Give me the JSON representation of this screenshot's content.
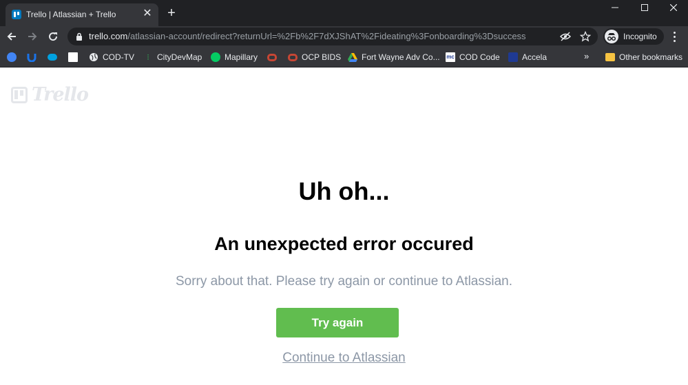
{
  "browser": {
    "tab": {
      "title": "Trello | Atlassian + Trello",
      "close": "✕"
    },
    "new_tab": "+",
    "omnibox": {
      "url_host": "trello.com",
      "url_path": "/atlassian-account/redirect?returnUrl=%2Fb%2F7dXJShAT%2Fideating%3Fonboarding%3Dsuccess"
    },
    "profile_label": "Incognito"
  },
  "bookmarks": {
    "items": [
      {
        "label": "",
        "icon": "arrow-circle-icon",
        "color": "#4285f4"
      },
      {
        "label": "",
        "icon": "magnet-icon",
        "color": "#1a73e8"
      },
      {
        "label": "",
        "icon": "salesforce-cloud-icon",
        "color": "#00a1e0"
      },
      {
        "label": "",
        "icon": "adobe-icon",
        "color": "#ffffff"
      },
      {
        "label": "COD-TV",
        "icon": "globe-icon",
        "color": "#e8eaed"
      },
      {
        "label": "CityDevMap",
        "icon": "map-icon",
        "color": "#34a853"
      },
      {
        "label": "Mapillary",
        "icon": "mapillary-icon",
        "color": "#05cb63"
      },
      {
        "label": "",
        "icon": "oracle-icon",
        "color": "#c74634"
      },
      {
        "label": "OCP BIDS",
        "icon": "oracle-icon",
        "color": "#c74634"
      },
      {
        "label": "Fort Wayne Adv Co...",
        "icon": "drive-icon",
        "color": "#fbbc04"
      },
      {
        "label": "COD Code",
        "icon": "municode-icon",
        "color": "#ffffff"
      },
      {
        "label": "Accela",
        "icon": "accela-icon",
        "color": "#1f3a93"
      }
    ],
    "overflow": "»",
    "other_bookmarks": "Other bookmarks"
  },
  "page": {
    "logo_text": "Trello",
    "headline": "Uh oh...",
    "subheadline": "An unexpected error occured",
    "message": "Sorry about that. Please try again or continue to Atlassian.",
    "try_again": "Try again",
    "continue_link": "Continue to Atlassian"
  },
  "colors": {
    "accent_green": "#61bd4f",
    "muted_text": "#8c97a6",
    "chrome_dark": "#202124",
    "chrome_toolbar": "#35363a"
  }
}
